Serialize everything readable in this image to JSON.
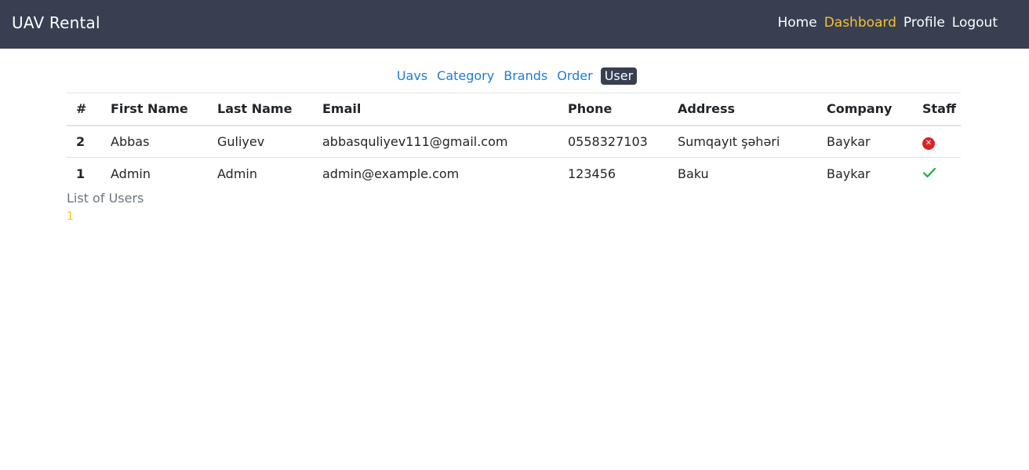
{
  "navbar": {
    "brand": "UAV Rental",
    "links": [
      {
        "label": "Home"
      },
      {
        "label": "Dashboard"
      },
      {
        "label": "Profile"
      },
      {
        "label": "Logout"
      }
    ],
    "active_color": "#f5c132",
    "background": "#373f51"
  },
  "subnav": {
    "items": [
      {
        "label": "Uavs"
      },
      {
        "label": "Category"
      },
      {
        "label": "Brands"
      },
      {
        "label": "Order"
      },
      {
        "label": "User"
      }
    ],
    "active": "User"
  },
  "table": {
    "headers": [
      "#",
      "First Name",
      "Last Name",
      "Email",
      "Phone",
      "Address",
      "Company",
      "Staff"
    ],
    "rows": [
      {
        "id": "2",
        "first_name": "Abbas",
        "last_name": "Guliyev",
        "email": "abbasquliyev111@gmail.com",
        "phone": "0558327103",
        "address": "Sumqayıt şəhəri",
        "company": "Baykar",
        "staff": "no",
        "staff_icon": "x-circle-icon"
      },
      {
        "id": "1",
        "first_name": "Admin",
        "last_name": "Admin",
        "email": "admin@example.com",
        "phone": "123456",
        "address": "Baku",
        "company": "Baykar",
        "staff": "yes",
        "staff_icon": "check-icon"
      }
    ],
    "caption": "List of Users"
  },
  "pagination": {
    "current": "1"
  }
}
